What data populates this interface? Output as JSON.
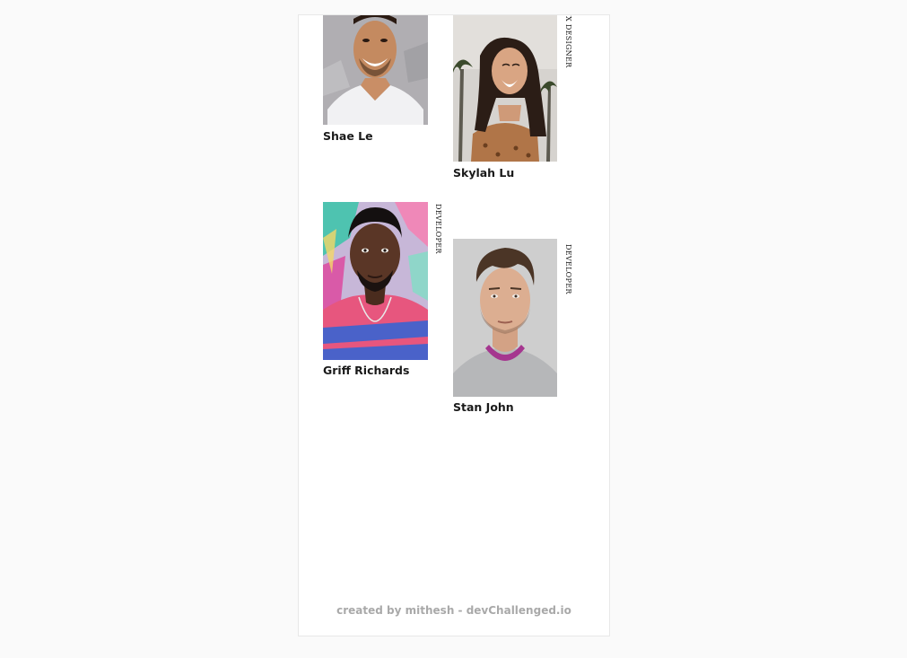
{
  "team": [
    {
      "name": "Shae Le",
      "role": "",
      "photo": "portrait-smiling-man-white-tshirt"
    },
    {
      "name": "Skylah Lu",
      "role": "UX DESIGNER",
      "photo": "portrait-laughing-woman-palms"
    },
    {
      "name": "Griff Richards",
      "role": "DEVELOPER",
      "photo": "portrait-man-striped-shirt-graffiti"
    },
    {
      "name": "Stan John",
      "role": "DEVELOPER",
      "photo": "portrait-man-grey-sweater"
    }
  ],
  "footer": {
    "text": "created by mithesh - devChallenged.io"
  },
  "colors": {
    "page_bg": "#fafafa",
    "card_bg": "#ffffff",
    "name": "#1a1a1a",
    "footer": "#a9a9a9"
  }
}
